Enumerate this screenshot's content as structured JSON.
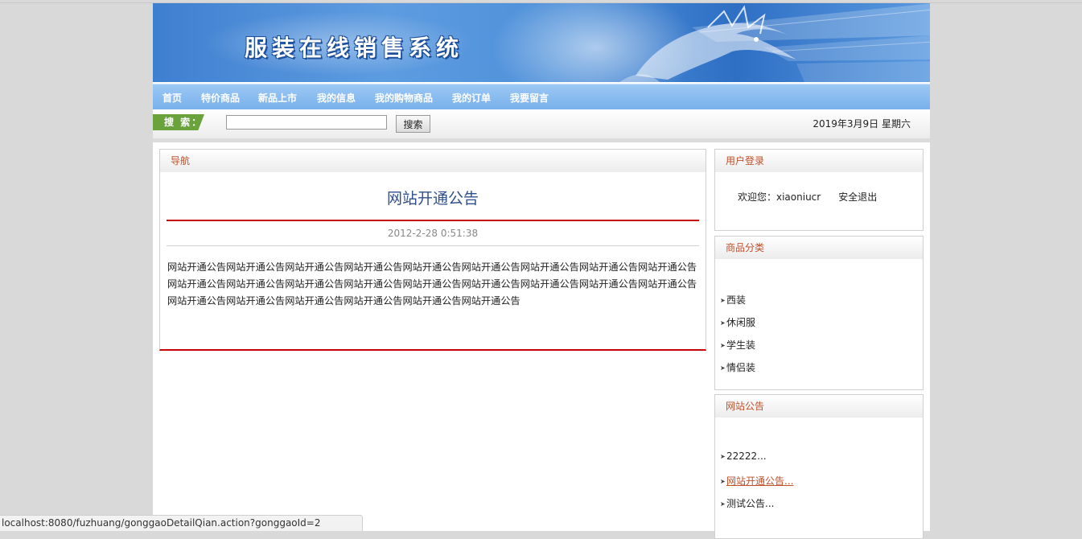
{
  "banner": {
    "title": "服装在线销售系统"
  },
  "nav": {
    "items": [
      "首页",
      "特价商品",
      "新品上市",
      "我的信息",
      "我的购物商品",
      "我的订单",
      "我要留言"
    ]
  },
  "search": {
    "label": "搜 索：",
    "value": "",
    "button": "搜索"
  },
  "date": "2019年3月9日 星期六",
  "main": {
    "panel_title": "导航",
    "notice_title": "网站开通公告",
    "notice_time": "2012-2-28 0:51:38",
    "notice_body": "网站开通公告网站开通公告网站开通公告网站开通公告网站开通公告网站开通公告网站开通公告网站开通公告网站开通公告网站开通公告网站开通公告网站开通公告网站开通公告网站开通公告网站开通公告网站开通公告网站开通公告网站开通公告网站开通公告网站开通公告网站开通公告网站开通公告网站开通公告网站开通公告"
  },
  "login": {
    "panel_title": "用户登录",
    "welcome": "欢迎您：xiaoniucr",
    "logout": "安全退出"
  },
  "categories": {
    "panel_title": "商品分类",
    "items": [
      "西装",
      "休闲服",
      "学生装",
      "情侣装"
    ]
  },
  "announcements": {
    "panel_title": "网站公告",
    "items": [
      "22222...",
      "网站开通公告...",
      "测试公告..."
    ],
    "active_index": 1
  },
  "statusbar": {
    "url": "localhost:8080/fuzhuang/gonggaoDetailQian.action?gonggaoId=2"
  },
  "colors": {
    "nav_bg": "#78b1ec",
    "accent_red": "#c40000",
    "panel_title": "#c0502a",
    "search_tag": "#6aa33b"
  }
}
